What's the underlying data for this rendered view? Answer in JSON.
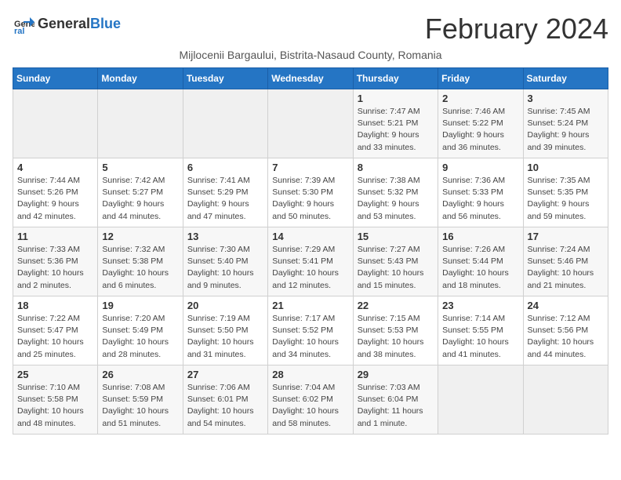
{
  "logo": {
    "general": "General",
    "blue": "Blue"
  },
  "title": "February 2024",
  "subtitle": "Mijlocenii Bargaului, Bistrita-Nasaud County, Romania",
  "weekdays": [
    "Sunday",
    "Monday",
    "Tuesday",
    "Wednesday",
    "Thursday",
    "Friday",
    "Saturday"
  ],
  "weeks": [
    [
      {
        "day": "",
        "info": ""
      },
      {
        "day": "",
        "info": ""
      },
      {
        "day": "",
        "info": ""
      },
      {
        "day": "",
        "info": ""
      },
      {
        "day": "1",
        "info": "Sunrise: 7:47 AM\nSunset: 5:21 PM\nDaylight: 9 hours and 33 minutes."
      },
      {
        "day": "2",
        "info": "Sunrise: 7:46 AM\nSunset: 5:22 PM\nDaylight: 9 hours and 36 minutes."
      },
      {
        "day": "3",
        "info": "Sunrise: 7:45 AM\nSunset: 5:24 PM\nDaylight: 9 hours and 39 minutes."
      }
    ],
    [
      {
        "day": "4",
        "info": "Sunrise: 7:44 AM\nSunset: 5:26 PM\nDaylight: 9 hours and 42 minutes."
      },
      {
        "day": "5",
        "info": "Sunrise: 7:42 AM\nSunset: 5:27 PM\nDaylight: 9 hours and 44 minutes."
      },
      {
        "day": "6",
        "info": "Sunrise: 7:41 AM\nSunset: 5:29 PM\nDaylight: 9 hours and 47 minutes."
      },
      {
        "day": "7",
        "info": "Sunrise: 7:39 AM\nSunset: 5:30 PM\nDaylight: 9 hours and 50 minutes."
      },
      {
        "day": "8",
        "info": "Sunrise: 7:38 AM\nSunset: 5:32 PM\nDaylight: 9 hours and 53 minutes."
      },
      {
        "day": "9",
        "info": "Sunrise: 7:36 AM\nSunset: 5:33 PM\nDaylight: 9 hours and 56 minutes."
      },
      {
        "day": "10",
        "info": "Sunrise: 7:35 AM\nSunset: 5:35 PM\nDaylight: 9 hours and 59 minutes."
      }
    ],
    [
      {
        "day": "11",
        "info": "Sunrise: 7:33 AM\nSunset: 5:36 PM\nDaylight: 10 hours and 2 minutes."
      },
      {
        "day": "12",
        "info": "Sunrise: 7:32 AM\nSunset: 5:38 PM\nDaylight: 10 hours and 6 minutes."
      },
      {
        "day": "13",
        "info": "Sunrise: 7:30 AM\nSunset: 5:40 PM\nDaylight: 10 hours and 9 minutes."
      },
      {
        "day": "14",
        "info": "Sunrise: 7:29 AM\nSunset: 5:41 PM\nDaylight: 10 hours and 12 minutes."
      },
      {
        "day": "15",
        "info": "Sunrise: 7:27 AM\nSunset: 5:43 PM\nDaylight: 10 hours and 15 minutes."
      },
      {
        "day": "16",
        "info": "Sunrise: 7:26 AM\nSunset: 5:44 PM\nDaylight: 10 hours and 18 minutes."
      },
      {
        "day": "17",
        "info": "Sunrise: 7:24 AM\nSunset: 5:46 PM\nDaylight: 10 hours and 21 minutes."
      }
    ],
    [
      {
        "day": "18",
        "info": "Sunrise: 7:22 AM\nSunset: 5:47 PM\nDaylight: 10 hours and 25 minutes."
      },
      {
        "day": "19",
        "info": "Sunrise: 7:20 AM\nSunset: 5:49 PM\nDaylight: 10 hours and 28 minutes."
      },
      {
        "day": "20",
        "info": "Sunrise: 7:19 AM\nSunset: 5:50 PM\nDaylight: 10 hours and 31 minutes."
      },
      {
        "day": "21",
        "info": "Sunrise: 7:17 AM\nSunset: 5:52 PM\nDaylight: 10 hours and 34 minutes."
      },
      {
        "day": "22",
        "info": "Sunrise: 7:15 AM\nSunset: 5:53 PM\nDaylight: 10 hours and 38 minutes."
      },
      {
        "day": "23",
        "info": "Sunrise: 7:14 AM\nSunset: 5:55 PM\nDaylight: 10 hours and 41 minutes."
      },
      {
        "day": "24",
        "info": "Sunrise: 7:12 AM\nSunset: 5:56 PM\nDaylight: 10 hours and 44 minutes."
      }
    ],
    [
      {
        "day": "25",
        "info": "Sunrise: 7:10 AM\nSunset: 5:58 PM\nDaylight: 10 hours and 48 minutes."
      },
      {
        "day": "26",
        "info": "Sunrise: 7:08 AM\nSunset: 5:59 PM\nDaylight: 10 hours and 51 minutes."
      },
      {
        "day": "27",
        "info": "Sunrise: 7:06 AM\nSunset: 6:01 PM\nDaylight: 10 hours and 54 minutes."
      },
      {
        "day": "28",
        "info": "Sunrise: 7:04 AM\nSunset: 6:02 PM\nDaylight: 10 hours and 58 minutes."
      },
      {
        "day": "29",
        "info": "Sunrise: 7:03 AM\nSunset: 6:04 PM\nDaylight: 11 hours and 1 minute."
      },
      {
        "day": "",
        "info": ""
      },
      {
        "day": "",
        "info": ""
      }
    ]
  ]
}
